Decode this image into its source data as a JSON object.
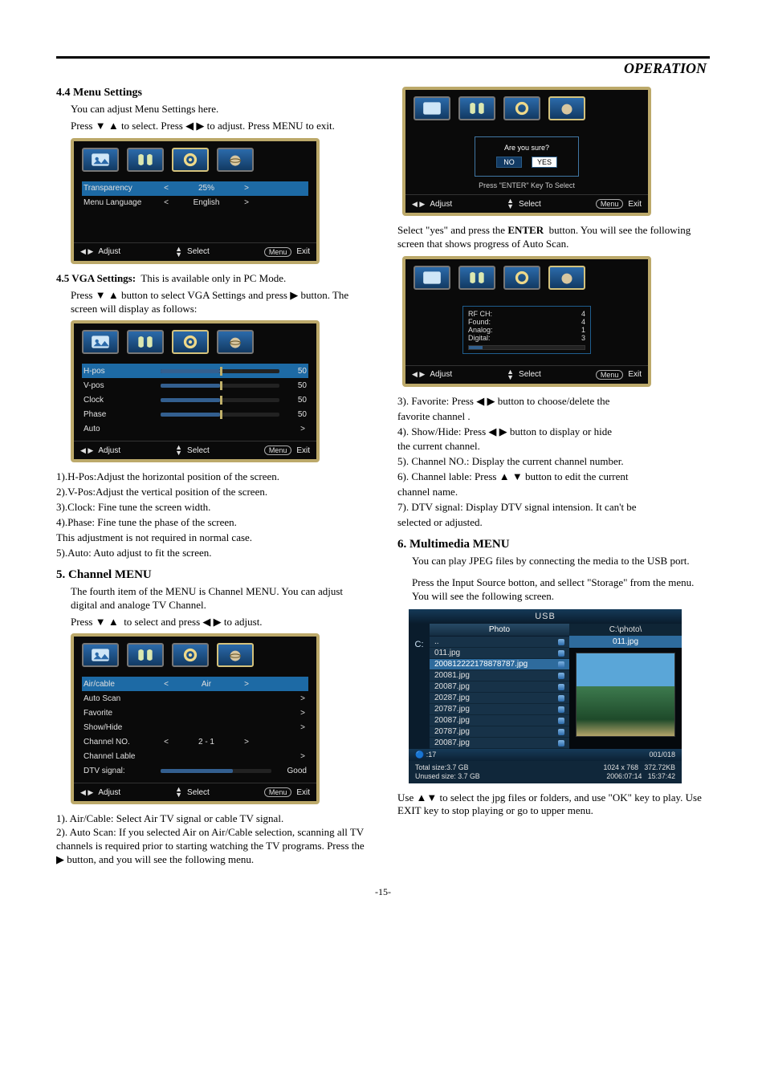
{
  "header": "OPERATION",
  "left": {
    "s44_title": "4.4  Menu Settings",
    "s44_p1": "You can adjust Menu Settings here.",
    "s44_p2a": "Press",
    "s44_p2b": "to select. Press",
    "s44_p2c": "to adjust. Press MENU to exit.",
    "osd44": {
      "row1": {
        "label": "Transparency",
        "val": "25%"
      },
      "row2": {
        "label": "Menu Language",
        "val": "English"
      },
      "foot_adjust": "Adjust",
      "foot_select": "Select",
      "foot_menu": "Menu",
      "foot_exit": "Exit"
    },
    "s45_title": "4.5  VGA Settings:",
    "s45_sub": "This is available only in PC Mode.",
    "s45_p1a": "Press",
    "s45_p1b": "button to select  VGA Settings and press",
    "s45_p1c": "button. The screen will  display as follows:",
    "osd45": {
      "rows": [
        {
          "label": "H-pos",
          "val": "50",
          "hl": true
        },
        {
          "label": "V-pos",
          "val": "50"
        },
        {
          "label": "Clock",
          "val": "50"
        },
        {
          "label": "Phase",
          "val": "50"
        },
        {
          "label": "Auto",
          "arrowOnly": true
        }
      ],
      "foot_adjust": "Adjust",
      "foot_select": "Select",
      "foot_menu": "Menu",
      "foot_exit": "Exit"
    },
    "vga_notes": [
      "1).H-Pos:Adjust the horizontal position of the screen.",
      "2).V-Pos:Adjust the vertical position of the screen.",
      "3).Clock: Fine tune the screen width.",
      "4).Phase: Fine tune the phase of  the screen.",
      "     This adjustment is not required in normal case.",
      "5).Auto: Auto adjust to fit the screen."
    ],
    "s5_title": "5. Channel  MENU",
    "s5_p1": "The fourth item of the MENU is Channel MENU. You can adjust digital and analoge TV Channel.",
    "s5_p2a": "Press",
    "s5_p2b": "to select and press",
    "s5_p2c": "to adjust.",
    "osd5": {
      "rows": [
        {
          "label": "Air/cable",
          "val": "Air",
          "arrows": true,
          "hl": true
        },
        {
          "label": "Auto  Scan",
          "chevron": true
        },
        {
          "label": "Favorite",
          "chevron": true
        },
        {
          "label": "Show/Hide",
          "chevron": true
        },
        {
          "label": "Channel NO.",
          "val": "2 - 1",
          "arrows": true
        },
        {
          "label": "Channel Lable",
          "chevron": true
        },
        {
          "label": "DTV signal:",
          "val": "Good",
          "slider": true
        }
      ],
      "foot_adjust": "Adjust",
      "foot_select": "Select",
      "foot_menu": "Menu",
      "foot_exit": "Exit"
    },
    "s5_notes": "1). Air/Cable: Select Air  TV signal or cable  TV signal.\n2). Auto Scan: If you selected Air on Air/Cable selection, scanning all TV channels is required prior to starting watching the TV programs. Press the  ▶  button, and you will see the following menu."
  },
  "right": {
    "confirm": {
      "q": "Are you sure?",
      "no": "NO",
      "yes": "YES",
      "hint": "Press \"ENTER\" Key To Select",
      "foot_adjust": "Adjust",
      "foot_select": "Select",
      "foot_menu": "Menu",
      "foot_exit": "Exit"
    },
    "confirm_p": "Select \"yes\" and press the  ENTER  button. You will see the following screen that shows progress of Auto Scan.",
    "scan": {
      "rf": "RF  CH:",
      "rf_v": "4",
      "found": "Found:",
      "found_v": "4",
      "analog": "Analog:",
      "analog_v": "1",
      "digital": "Digital:",
      "digital_v": "3",
      "foot_adjust": "Adjust",
      "foot_select": "Select",
      "foot_menu": "Menu",
      "foot_exit": "Exit"
    },
    "ch_notes": [
      "3). Favorite: Press ◀ ▶ button to choose/delete the",
      "      favorite channel .",
      "4). Show/Hide: Press ◀ ▶ button to display or hide",
      "      the current channel.",
      "5). Channel NO.: Display the current channel number.",
      "6). Channel lable: Press  ▲ ▼ button to edit the current",
      "      channel name.",
      "7). DTV signal: Display DTV signal intension. It can't be",
      "      selected or adjusted."
    ],
    "s6_title": "6. Multimedia  MENU",
    "s6_p1": "You can play JPEG files by connecting the media to the USB port.",
    "s6_p2": "Press the Input Source botton, and sellect \"Storage\" from the menu. You will see the following screen.",
    "usb": {
      "title": "USB",
      "drive": "C:",
      "tab": "Photo",
      "path": "C:\\photo\\",
      "cur": "011.jpg",
      "items": [
        "..",
        "011.jpg",
        "200812222178878787.jpg",
        "20081.jpg",
        "20087.jpg",
        "20287.jpg",
        "20787.jpg",
        "20087.jpg",
        "20787.jpg",
        "20087.jpg"
      ],
      "sel_index": 2,
      "bar_left": ":17",
      "bar_right": "001/018",
      "foot_l1": "Total size:3.7 GB",
      "foot_l2": "Unused size: 3.7 GB",
      "foot_r1": "1024 x 768",
      "foot_r2": "2006:07:14",
      "foot_r1b": "372.72KB",
      "foot_r2b": "15:37:42"
    },
    "s6_p3": "Use  ▲▼  to select the jpg files or folders, and use \"OK\" key to play. Use EXIT key to stop playing or go to upper menu."
  },
  "page_num": "-15-"
}
